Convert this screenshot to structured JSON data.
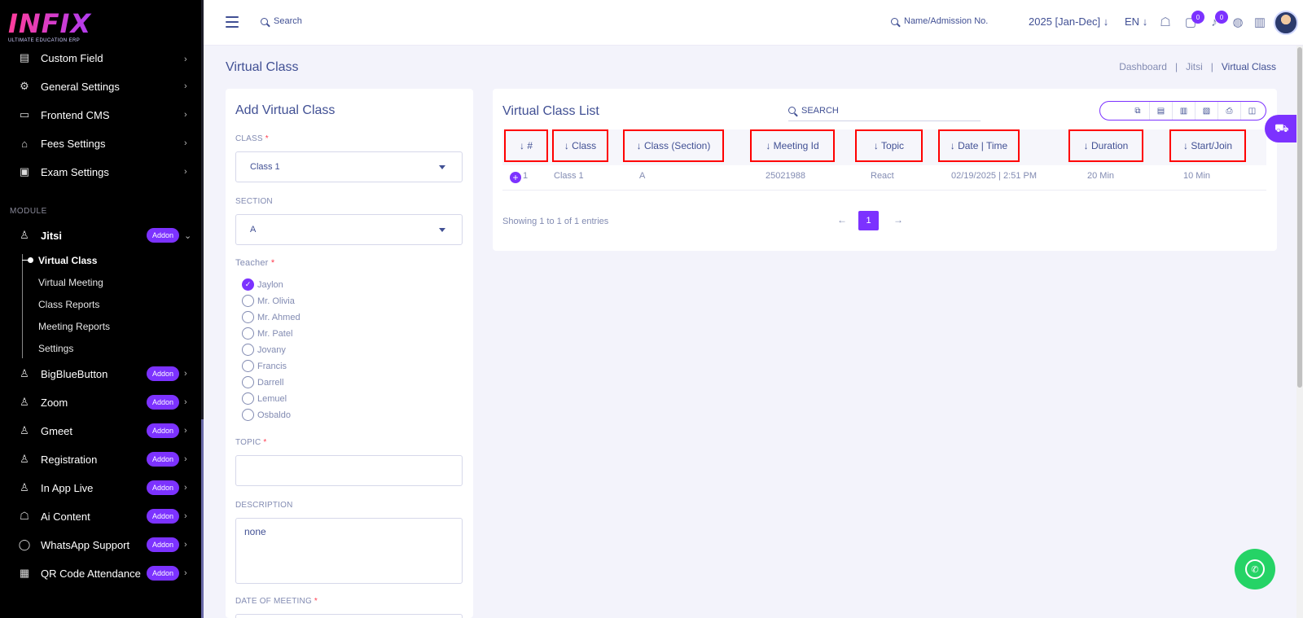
{
  "logo": {
    "word": "INFIX",
    "sub": "ULTIMATE EDUCATION ERP"
  },
  "sidebar": {
    "items": [
      {
        "label": "Custom Field",
        "icon": "field-icon"
      },
      {
        "label": "General Settings",
        "icon": "gears-icon"
      },
      {
        "label": "Frontend CMS",
        "icon": "monitor-icon"
      },
      {
        "label": "Fees Settings",
        "icon": "bank-icon"
      },
      {
        "label": "Exam Settings",
        "icon": "book-icon"
      }
    ],
    "module_title": "MODULE",
    "modules": [
      {
        "label": "Jitsi",
        "addon": "Addon"
      },
      {
        "label": "BigBlueButton",
        "addon": "Addon"
      },
      {
        "label": "Zoom",
        "addon": "Addon"
      },
      {
        "label": "Gmeet",
        "addon": "Addon"
      },
      {
        "label": "Registration",
        "addon": "Addon"
      },
      {
        "label": "In App Live",
        "addon": "Addon"
      },
      {
        "label": "Ai Content",
        "addon": "Addon"
      },
      {
        "label": "WhatsApp Support",
        "addon": "Addon"
      },
      {
        "label": "QR Code Attendance",
        "addon": "Addon"
      }
    ],
    "jitsi_sub": [
      "Virtual Class",
      "Virtual Meeting",
      "Class Reports",
      "Meeting Reports",
      "Settings"
    ]
  },
  "topbar": {
    "search_label": "Search",
    "name_search": "Name/Admission No.",
    "year": "2025 [Jan-Dec]",
    "lang": "EN",
    "chat_badge": "0",
    "notif_badge": "0"
  },
  "page": {
    "title": "Virtual Class",
    "breadcrumb": [
      "Dashboard",
      "Jitsi",
      "Virtual Class"
    ]
  },
  "form": {
    "title": "Add Virtual Class",
    "class_label": "CLASS",
    "class_value": "Class 1",
    "section_label": "SECTION",
    "section_value": "A",
    "teacher_label": "Teacher",
    "teachers": [
      "Jaylon",
      "Mr. Olivia",
      "Mr. Ahmed",
      "Mr. Patel",
      "Jovany",
      "Francis",
      "Darrell",
      "Lemuel",
      "Osbaldo"
    ],
    "selected_teacher": "Jaylon",
    "topic_label": "TOPIC",
    "topic_value": "",
    "description_label": "DESCRIPTION",
    "description_value": "none",
    "date_label": "DATE OF MEETING",
    "required_mark": "*"
  },
  "list": {
    "title": "Virtual Class List",
    "search_label": "SEARCH",
    "columns": [
      "↓ #",
      "↓ Class",
      "↓ Class (Section)",
      "↓ Meeting Id",
      "↓ Topic",
      "↓ Date | Time",
      "↓ Duration",
      "↓ Start/Join"
    ],
    "rows": [
      {
        "num": "1",
        "class": "Class 1",
        "section": "A",
        "meeting_id": "25021988",
        "topic": "React",
        "datetime": "02/19/2025 | 2:51 PM",
        "duration": "20 Min",
        "start": "10 Min"
      }
    ],
    "showing": "Showing 1 to 1 of 1 entries",
    "current_page": "1",
    "toolbar_icons": [
      "copy-icon",
      "excel-icon",
      "csv-icon",
      "pdf-icon",
      "print-icon",
      "columns-icon"
    ]
  },
  "colors": {
    "accent": "#7c32ff",
    "text": "#415094",
    "muted": "#828bb2",
    "highlight": "#ff0000",
    "whatsapp": "#25d366"
  }
}
